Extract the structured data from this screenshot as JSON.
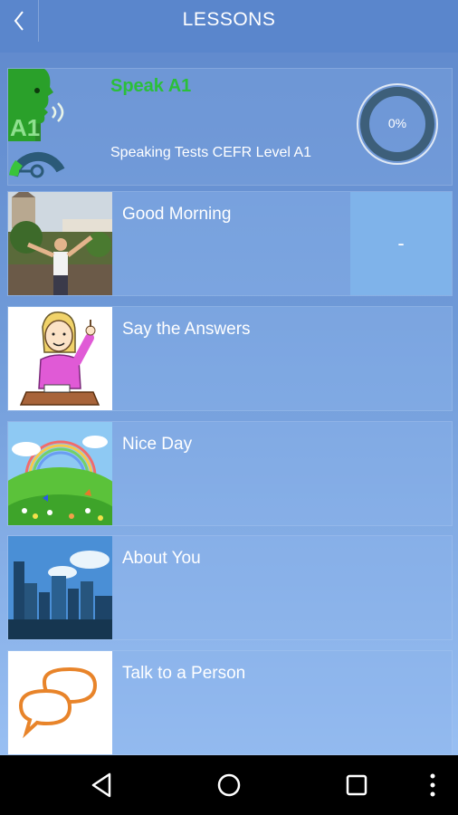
{
  "header": {
    "title": "LESSONS"
  },
  "course": {
    "title": "Speak A1",
    "subtitle": "Speaking Tests CEFR Level A1",
    "progress_label": "0%",
    "progress_value": 0,
    "logo_text": "A1"
  },
  "lessons": [
    {
      "title": "Good Morning",
      "score": "-"
    },
    {
      "title": "Say the Answers"
    },
    {
      "title": "Nice Day"
    },
    {
      "title": "About You"
    },
    {
      "title": "Talk to a Person"
    }
  ],
  "colors": {
    "accent_green": "#2bbf3a",
    "appbar": "#5a86cc",
    "score_box": "#7fb3ea"
  },
  "icons": {
    "back": "back-arrow-icon",
    "nav_back": "nav-back-icon",
    "nav_home": "nav-home-icon",
    "nav_recents": "nav-recents-icon",
    "nav_more": "more-vertical-icon"
  }
}
